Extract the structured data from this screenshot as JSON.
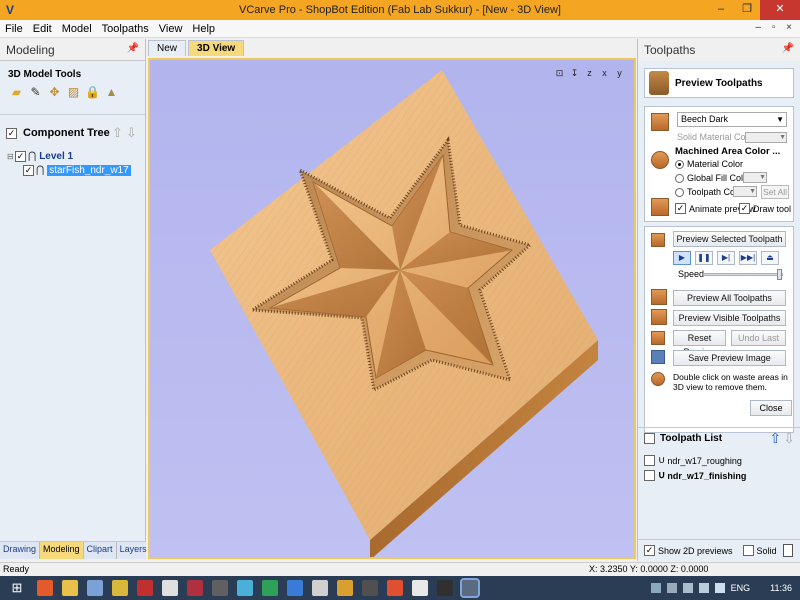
{
  "window": {
    "title": "VCarve Pro - ShopBot Edition (Fab Lab Sukkur) - [New - 3D View]",
    "controls": [
      "–",
      "❐",
      "✕"
    ]
  },
  "menu": {
    "items": [
      "File",
      "Edit",
      "Model",
      "Toolpaths",
      "View",
      "Help"
    ],
    "mdi_controls": "– ▫ ×"
  },
  "left_panel": {
    "title": "Modeling",
    "model_tools_title": "3D Model Tools",
    "tool_icons": [
      "folder-icon",
      "magic-wand-icon",
      "arrows-icon",
      "slice-icon",
      "lock-icon",
      "mesh-icon"
    ],
    "component_tree_label": "Component Tree",
    "tree": {
      "level": "Level 1",
      "child": "starFish_ndr_w17"
    },
    "tabs": [
      "Drawing",
      "Modeling",
      "Clipart",
      "Layers"
    ],
    "active_tab": "Modeling"
  },
  "view": {
    "tabs": [
      "New",
      "3D View"
    ],
    "active_tab": "3D View",
    "toolbar": [
      "⊡",
      "↧",
      "z",
      "x",
      "y"
    ]
  },
  "right_panel": {
    "title": "Toolpaths",
    "preview_title": "Preview Toolpaths",
    "material_select": "Beech Dark",
    "solid_material_color": "Solid Material Color",
    "machined_area_title": "Machined Area Color ...",
    "radio_material": "Material Color",
    "radio_global": "Global Fill Color",
    "radio_toolpath": "Toolpath Color",
    "set_all": "Set All",
    "animate_preview": "Animate preview",
    "draw_tool": "Draw tool",
    "btn_preview_selected": "Preview Selected Toolpath",
    "speed_label": "Speed",
    "speed_value": 0.97,
    "btn_preview_all": "Preview All Toolpaths",
    "btn_preview_visible": "Preview Visible Toolpaths",
    "btn_reset": "Reset Preview",
    "btn_undo_last": "Undo Last",
    "btn_save_image": "Save Preview Image",
    "hint": "Double click on waste areas in 3D view to remove them.",
    "close": "Close",
    "toolpath_list_title": "Toolpath List",
    "toolpaths": [
      "ndr_w17_roughing",
      "ndr_w17_finishing"
    ],
    "show_2d_previews": "Show 2D previews",
    "solid": "Solid"
  },
  "status": {
    "ready": "Ready",
    "coords": "X: 3.2350 Y: 0.0000 Z: 0.0000"
  },
  "taskbar": {
    "lang": "ENG",
    "time": "11:36"
  },
  "colors": {
    "title_bar": "#f4a522",
    "view_bg": "#b2b4ee",
    "wood_top": "#f0c089",
    "wood_side": "#b87535",
    "accent_tab": "#f5d97a"
  }
}
